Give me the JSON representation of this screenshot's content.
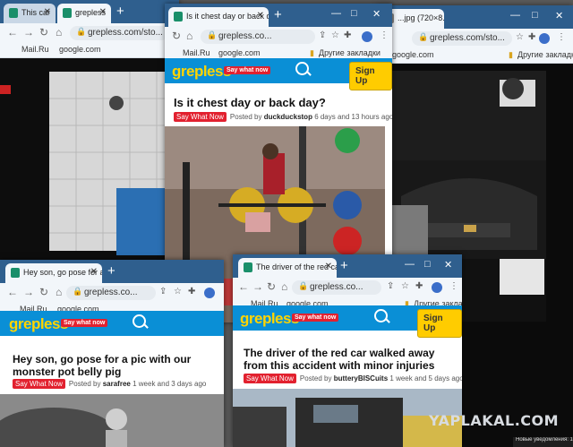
{
  "brand": {
    "logo": "grepless",
    "tagline": "Say what now",
    "signup": "Sign Up"
  },
  "bookmarks": {
    "mailru": "Mail.Ru",
    "google": "google.com",
    "other": "Другие закладки"
  },
  "win1": {
    "tabs": [
      {
        "label": "This car"
      },
      {
        "label": "grepless"
      }
    ],
    "address": "grepless.com/sto..."
  },
  "win2": {
    "tab": "Is it chest day or back day? /",
    "address": "grepless.co...",
    "post": {
      "title": "Is it chest day or back day?",
      "tag": "Say What Now",
      "posted_by": "Posted by",
      "author": "duckduckstop",
      "time": "6 days and 13 hours ago"
    }
  },
  "win3": {
    "tab": "...jpg (720×8...",
    "address": "grepless.com/sto..."
  },
  "win4": {
    "tab": "Hey son, go pose for a pic wi",
    "address": "grepless.co...",
    "post": {
      "title": "Hey son, go pose for a pic with our monster pot belly pig",
      "tag": "Say What Now",
      "posted_by": "Posted by",
      "author": "sarafree",
      "time": "1 week and 3 days ago"
    }
  },
  "win5": {
    "tab": "The driver of the red car walk",
    "address": "grepless.co...",
    "post": {
      "title": "The driver of the red car walked away from this accident with minor injuries",
      "tag": "Say What Now",
      "posted_by": "Posted by",
      "author": "butteryBISCuits",
      "time": "1 week and 5 days ago"
    }
  },
  "overlay": {
    "watermark": "YAPLAKAL.COM",
    "notification": "Новые уведомления: 1"
  },
  "icons": [
    "favicon-icon",
    "close-icon",
    "new-tab-icon",
    "back-icon",
    "forward-icon",
    "reload-icon",
    "home-icon",
    "lock-icon",
    "share-icon",
    "star-icon",
    "extension-icon",
    "menu-icon",
    "search-icon",
    "folder-icon"
  ],
  "colors": {
    "header_blue": "#0a8fd6",
    "logo_yellow": "#ffd400",
    "tag_red": "#e2212f",
    "titlebar": "#2f5f8e"
  }
}
